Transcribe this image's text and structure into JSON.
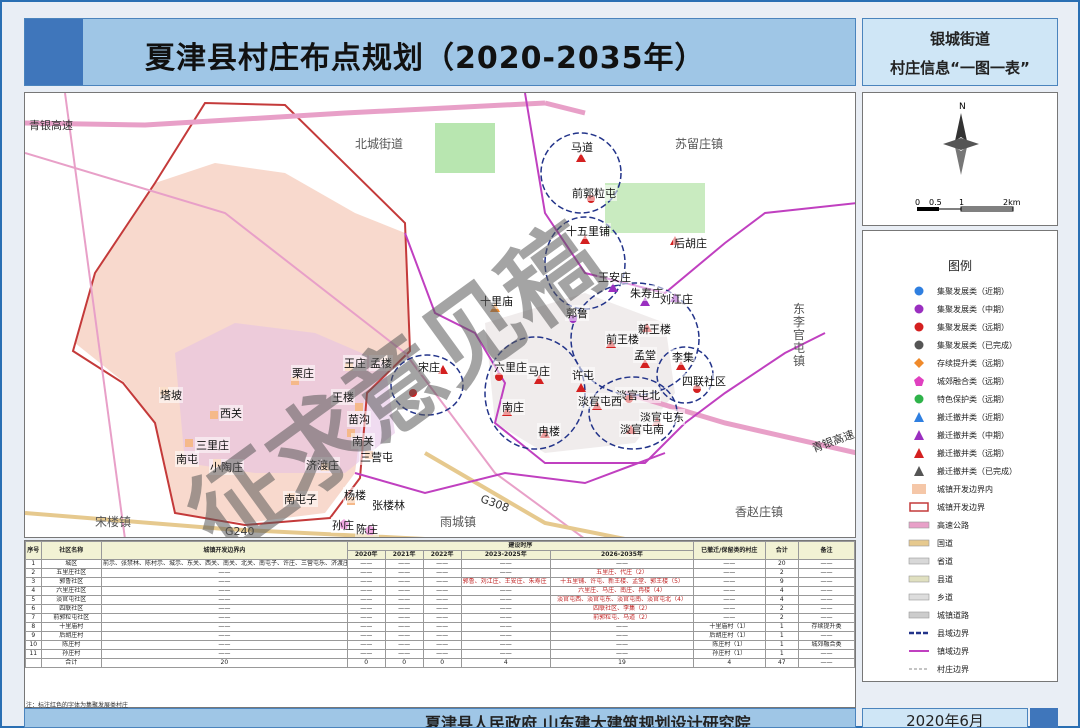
{
  "title": "夏津县村庄布点规划（2020-2035年）",
  "info": {
    "line1": "银城街道",
    "line2": "村庄信息“一图一表”"
  },
  "compass": {
    "north": "N",
    "scale": [
      "0",
      "0.5",
      "1",
      "2km"
    ]
  },
  "map": {
    "region_labels": [
      "北城街道",
      "苏留庄镇",
      "东李官屯镇",
      "雨城镇",
      "香赵庄镇",
      "宋楼镇",
      "青银高速",
      "青银高速",
      "G308",
      "G240"
    ],
    "villages": [
      "马道",
      "前郭粒屯",
      "十五里铺",
      "后胡庄",
      "王安庄",
      "朱寿庄",
      "刘江庄",
      "十里庙",
      "郭鲁",
      "前王楼",
      "新王楼",
      "孟堂",
      "李集",
      "四联社区",
      "六里庄",
      "马庄",
      "许屯",
      "淡官屯北",
      "淡官屯西",
      "淡官屯东",
      "淡官屯南",
      "南庄",
      "冉楼",
      "宋庄",
      "塔坡",
      "王庄",
      "栗庄",
      "孟楼",
      "王楼",
      "苗沟",
      "南关",
      "西关",
      "三里庄",
      "南屯",
      "三营屯",
      "济渡庄",
      "小陶庄",
      "南屯子",
      "杨楼",
      "张楼林",
      "孙庄",
      "陈庄"
    ],
    "watermark": "征求意见稿"
  },
  "legend": {
    "title": "图例",
    "items": [
      {
        "label": "集聚发展类（近期）",
        "symbol": "circle",
        "color": "#2f7fe0"
      },
      {
        "label": "集聚发展类（中期）",
        "symbol": "circle",
        "color": "#9a2fc0"
      },
      {
        "label": "集聚发展类（远期）",
        "symbol": "circle",
        "color": "#d42020"
      },
      {
        "label": "集聚发展类（已完成）",
        "symbol": "circle",
        "color": "#555555"
      },
      {
        "label": "存续提升类（远期）",
        "symbol": "diamond",
        "color": "#f08a2a"
      },
      {
        "label": "城郊融合类（远期）",
        "symbol": "pentagon",
        "color": "#e040c0"
      },
      {
        "label": "特色保护类（远期）",
        "symbol": "circle",
        "color": "#2fb34a"
      },
      {
        "label": "搬迁撤并类（近期）",
        "symbol": "triangle",
        "color": "#2f7fe0"
      },
      {
        "label": "搬迁撤并类（中期）",
        "symbol": "triangle",
        "color": "#9a2fc0"
      },
      {
        "label": "搬迁撤并类（远期）",
        "symbol": "triangle",
        "color": "#d42020"
      },
      {
        "label": "搬迁撤并类（已完成）",
        "symbol": "triangle",
        "color": "#555555"
      },
      {
        "label": "城镇开发边界内",
        "symbol": "fill",
        "color": "#f5c7a8"
      },
      {
        "label": "城镇开发边界",
        "symbol": "outline",
        "color": "#c43a3a"
      },
      {
        "label": "高速公路",
        "symbol": "road",
        "color": "#e8a0c8"
      },
      {
        "label": "国道",
        "symbol": "road",
        "color": "#e6c98e"
      },
      {
        "label": "省道",
        "symbol": "road",
        "color": "#d8d8d8"
      },
      {
        "label": "县道",
        "symbol": "road",
        "color": "#e0e0c0"
      },
      {
        "label": "乡道",
        "symbol": "road",
        "color": "#dddddd"
      },
      {
        "label": "城镇道路",
        "symbol": "road",
        "color": "#cccccc"
      },
      {
        "label": "县域边界",
        "symbol": "dash",
        "color": "#23348a"
      },
      {
        "label": "镇域边界",
        "symbol": "line",
        "color": "#c040c0"
      },
      {
        "label": "村庄边界",
        "symbol": "thin",
        "color": "#888888"
      }
    ]
  },
  "table": {
    "headers_row1": [
      "序号",
      "社区名称",
      "城镇开发边界内",
      "建设时序",
      "已撤迁/保留类的村庄",
      "合计",
      "备注"
    ],
    "headers_row2": [
      "2020年",
      "2021年",
      "2022年",
      "2023-2025年",
      "2026-2035年"
    ],
    "rows": [
      [
        "1",
        "城区",
        "前示、张禁林、陈村示、城示、东关、西关、南关、北关、南屯子、许庄、三营屯乐、济渡庄、北关东、刘庄、北关、栗庄、苗沟、孟楼、王楼、南屯（20）",
        "——",
        "——",
        "——",
        "——",
        "——",
        "——",
        "20",
        "——"
      ],
      [
        "2",
        "五里庄社区",
        "——",
        "——",
        "——",
        "——",
        "——",
        "五里庄、代庄（2）",
        "——",
        "2",
        "——"
      ],
      [
        "3",
        "郭鲁社区",
        "——",
        "——",
        "——",
        "——",
        "郭鲁、刘江庄、王安庄、朱寿庄（4）",
        "十五里铺、许屯、新王楼、孟堂、郭王楼（5）",
        "——",
        "9",
        "——"
      ],
      [
        "4",
        "六里庄社区",
        "——",
        "——",
        "——",
        "——",
        "——",
        "六里庄、马庄、南庄、冉楼（4）",
        "——",
        "4",
        "——"
      ],
      [
        "5",
        "淡官屯社区",
        "——",
        "——",
        "——",
        "——",
        "——",
        "淡官屯西、淡官屯东、淡官屯南、淡官屯北（4）",
        "——",
        "4",
        "——"
      ],
      [
        "6",
        "四联社区",
        "——",
        "——",
        "——",
        "——",
        "——",
        "四联社区、李集（2）",
        "——",
        "2",
        "——"
      ],
      [
        "7",
        "前郭粒屯社区",
        "——",
        "——",
        "——",
        "——",
        "——",
        "前郭粒屯、马道（2）",
        "——",
        "2",
        "——"
      ],
      [
        "8",
        "十里庙村",
        "——",
        "——",
        "——",
        "——",
        "——",
        "——",
        "十里庙村（1）",
        "1",
        "存续提升类"
      ],
      [
        "9",
        "后胡庄村",
        "——",
        "——",
        "——",
        "——",
        "——",
        "——",
        "后胡庄村（1）",
        "1",
        "——"
      ],
      [
        "10",
        "陈庄村",
        "——",
        "——",
        "——",
        "——",
        "——",
        "——",
        "陈庄村（1）",
        "1",
        "城郊融合类"
      ],
      [
        "11",
        "孙庄村",
        "——",
        "——",
        "——",
        "——",
        "——",
        "——",
        "孙庄村（1）",
        "1",
        "——"
      ],
      [
        "",
        "合计",
        "20",
        "0",
        "0",
        "0",
        "4",
        "19",
        "4",
        "47",
        "——"
      ]
    ],
    "note": "注：标注红色的字体为集聚发展类村庄"
  },
  "footer": {
    "org": "夏津县人民政府   山东建大建筑规划设计研究院",
    "date": "2020年6月"
  }
}
